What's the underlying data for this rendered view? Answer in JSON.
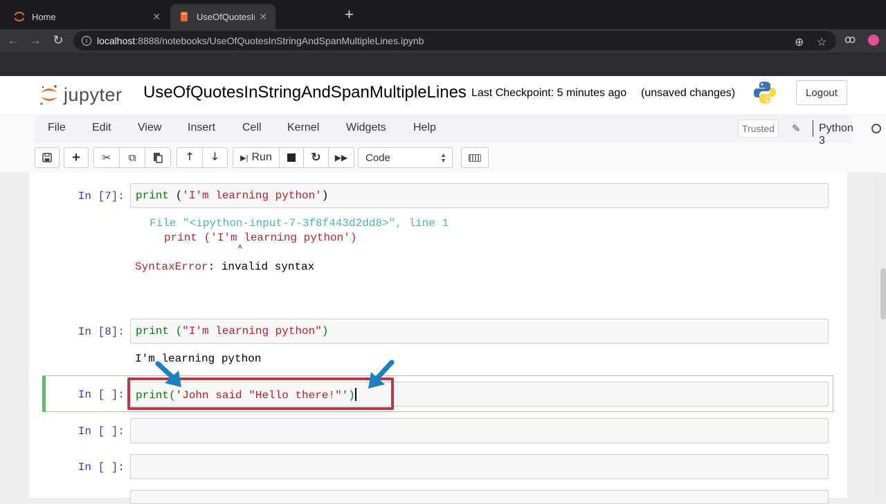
{
  "browser": {
    "tabs": [
      {
        "label": "Home",
        "icon": "jupyter-icon",
        "active": false
      },
      {
        "label": "UseOfQuotesInStringAndSpanMultipleLines.ipynb",
        "label_visible": "UseOfQuotesInStringAndSpan",
        "icon": "notebook-icon",
        "active": true
      }
    ],
    "url_host": "localhost",
    "url_path": ":8888/notebooks/UseOfQuotesInStringAndSpanMultipleLines.ipynb",
    "profile_color": "#e0519b"
  },
  "header": {
    "logo_text": "jupyter",
    "notebook_name": "UseOfQuotesInStringAndSpanMultipleLines",
    "checkpoint": "Last Checkpoint: 5 minutes ago",
    "save_status": "(unsaved changes)",
    "logout_label": "Logout"
  },
  "menubar": {
    "items": [
      "File",
      "Edit",
      "View",
      "Insert",
      "Cell",
      "Kernel",
      "Widgets",
      "Help"
    ],
    "trusted_label": "Trusted",
    "kernel_name": "Python 3"
  },
  "toolbar": {
    "run_label": "Run",
    "cell_type": "Code"
  },
  "cells": [
    {
      "prompt": "In [7]:",
      "code": {
        "fn": "print",
        "open": " (",
        "str": "'I'm learning python'",
        "close": ")"
      },
      "error": {
        "file_prefix": "File ",
        "file_name": "\"<ipython-input-7-3f8f443d2dd8>\"",
        "file_suffix": ", line 1",
        "code_line": "print ('I'm learning python')",
        "caret": "^",
        "error_type": "SyntaxError",
        "error_msg": ": invalid syntax"
      }
    },
    {
      "prompt": "In [8]:",
      "code": {
        "fn": "print",
        "open": " (",
        "str": "\"I'm learning python\"",
        "close": ")"
      },
      "output": "I'm learning python"
    },
    {
      "prompt": "In [ ]:",
      "code": {
        "fn": "print",
        "open": "(",
        "str": "'John said \"Hello there!\"'",
        "close": ")"
      },
      "selected": true
    },
    {
      "prompt": "In [ ]:"
    },
    {
      "prompt": "In [ ]:"
    }
  ],
  "annotations": {
    "highlight_color": "#b13e47",
    "arrow_color": "#1b7fc1"
  }
}
